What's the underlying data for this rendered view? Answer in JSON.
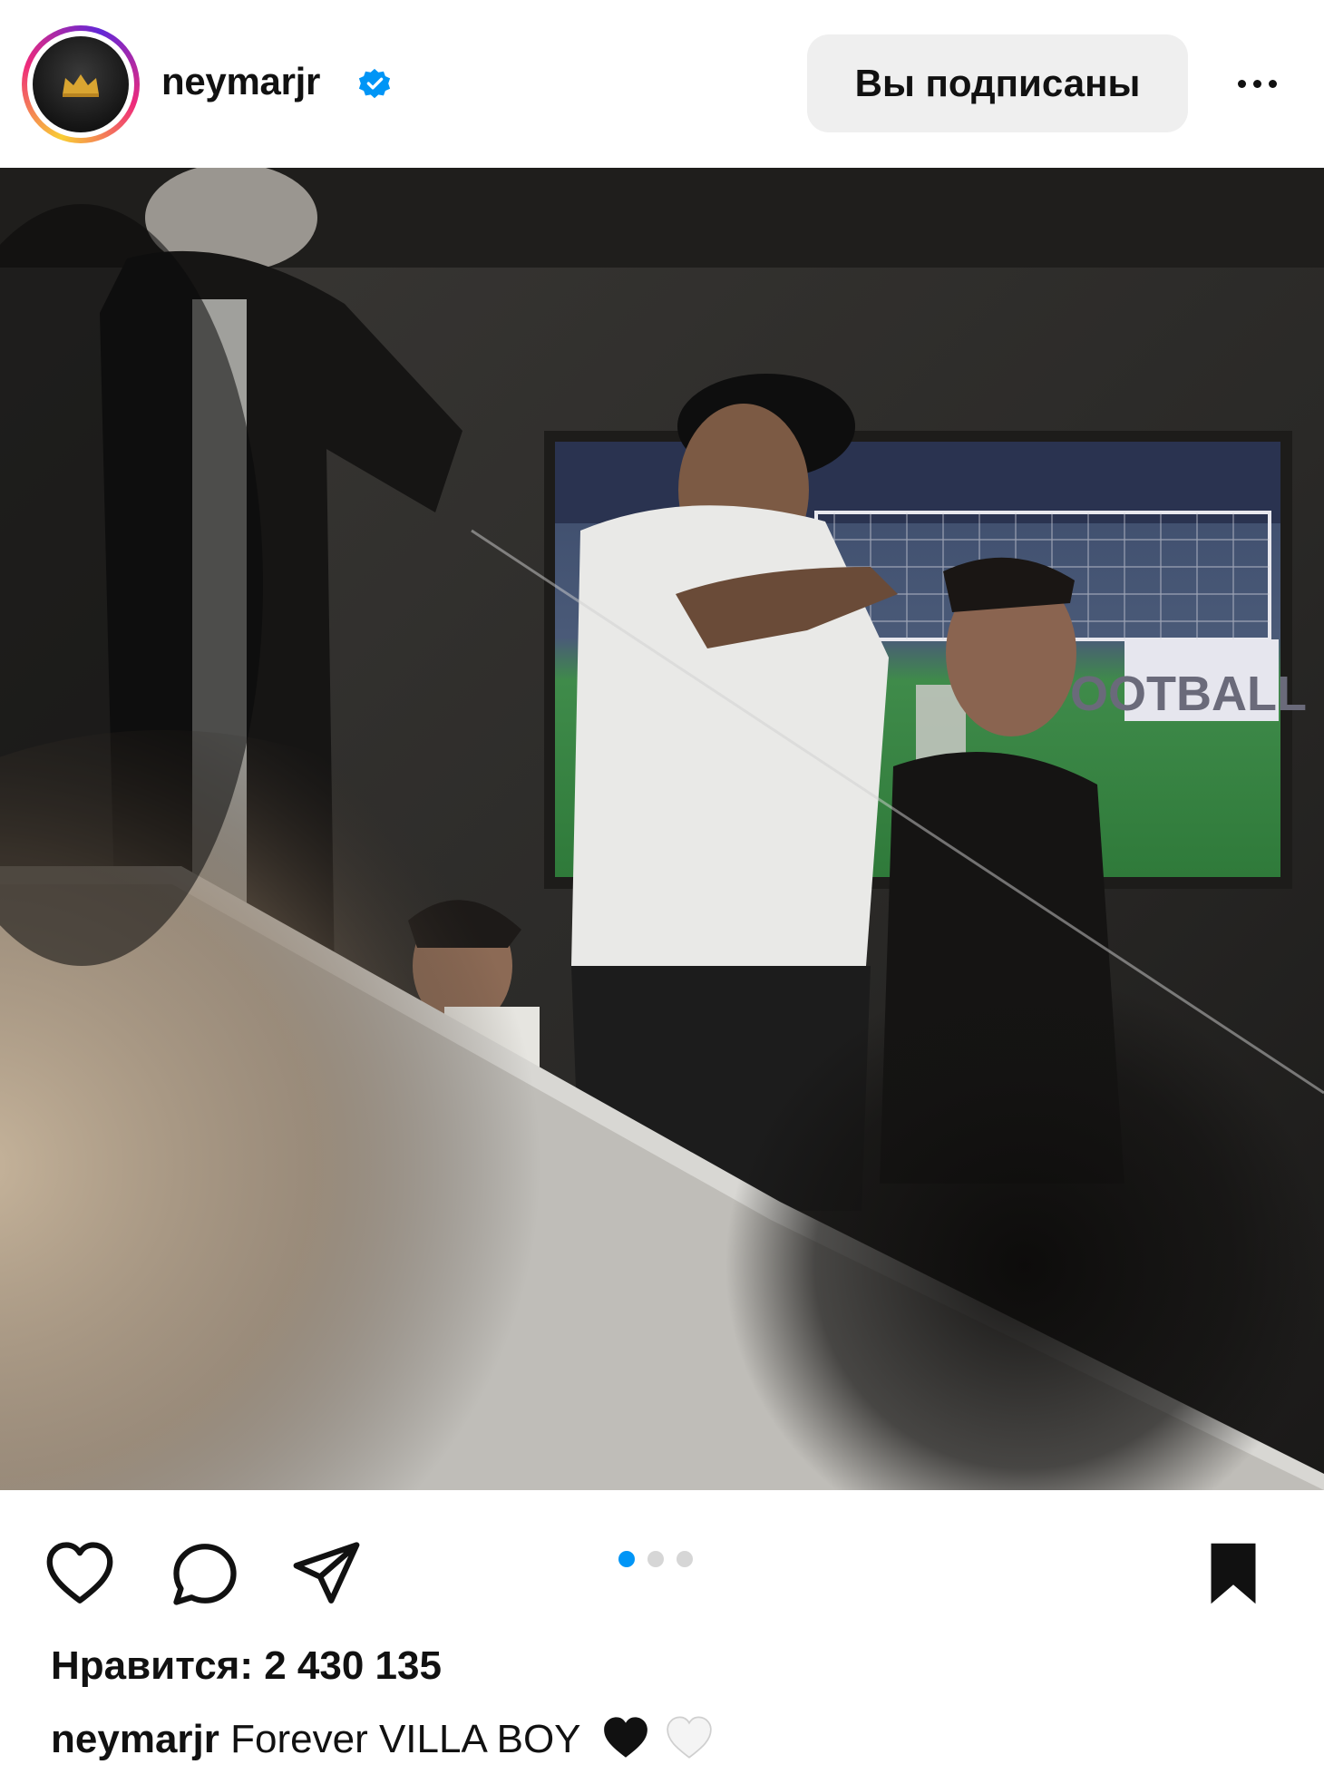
{
  "post": {
    "username": "neymarjr",
    "follow_label": "Вы подписаны",
    "likes_text": "Нравится: 2 430 135",
    "caption_user": "neymarjr",
    "caption_text": "Forever VILLA BOY",
    "caption_emojis": [
      "black-heart",
      "white-heart"
    ]
  },
  "carousel": {
    "total": 3,
    "active_index": 0
  },
  "photo": {
    "screen_text": "OOTBALL"
  },
  "colors": {
    "verified": "#0095f6",
    "carousel_active": "#0095f6",
    "follow_bg": "#efefef"
  },
  "icons": [
    "heart-icon",
    "comment-icon",
    "share-icon",
    "bookmark-icon",
    "more-icon",
    "verified-icon"
  ]
}
